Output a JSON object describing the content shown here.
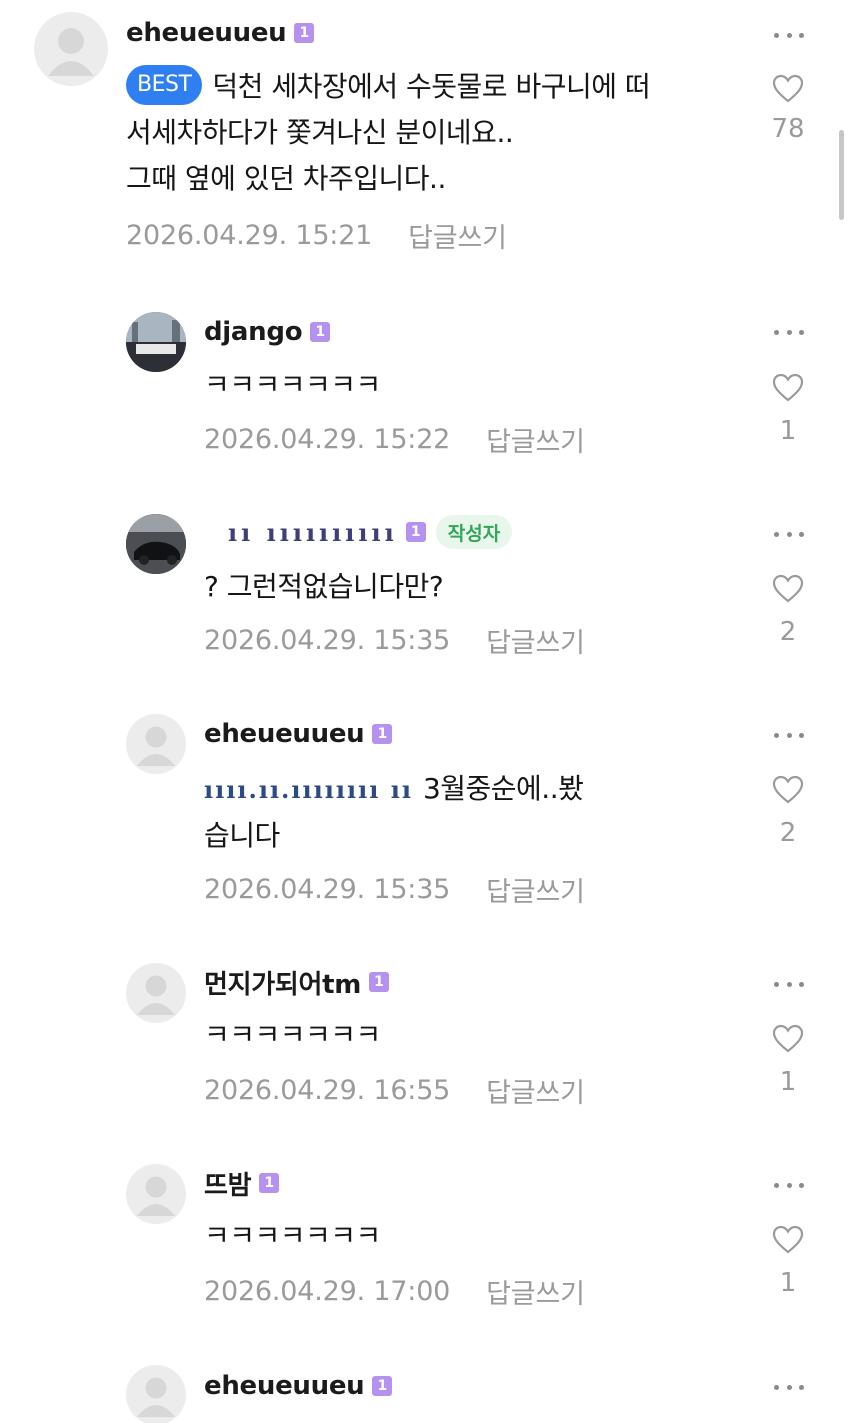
{
  "comments": [
    {
      "username": "eheueuueu",
      "level": "1",
      "badge": "BEST",
      "text": "덕천 세차장에서 수돗물로 바구니에 떠\n서세차하다가 쫓겨나신 분이네요..\n그때 옆에 있던 차주입니다..",
      "timestamp": "2026.04.29. 15:21",
      "reply_label": "답글쓰기",
      "likes": "78"
    },
    {
      "username": "django",
      "level": "1",
      "text": "ㅋㅋㅋㅋㅋㅋㅋ",
      "timestamp": "2026.04.29. 15:22",
      "reply_label": "답글쓰기",
      "likes": "1"
    },
    {
      "username": "ıı ıııııııııı",
      "level": "1",
      "author_badge": "작성자",
      "text": "? 그런적없습니다만?",
      "timestamp": "2026.04.29. 15:35",
      "reply_label": "답글쓰기",
      "likes": "2"
    },
    {
      "username": "eheueuueu",
      "level": "1",
      "masked_prefix": "ıııı.ıı.ıııııııı ıı",
      "text": "3월중순에..봤\n습니다",
      "timestamp": "2026.04.29. 15:35",
      "reply_label": "답글쓰기",
      "likes": "2"
    },
    {
      "username": "먼지가되어tm",
      "level": "1",
      "text": "ㅋㅋㅋㅋㅋㅋㅋ",
      "timestamp": "2026.04.29. 16:55",
      "reply_label": "답글쓰기",
      "likes": "1"
    },
    {
      "username": "뜨밤",
      "level": "1",
      "text": "ㅋㅋㅋㅋㅋㅋㅋ",
      "timestamp": "2026.04.29. 17:00",
      "reply_label": "답글쓰기",
      "likes": "1"
    },
    {
      "username": "eheueuueu",
      "level": "1"
    }
  ],
  "icons": {
    "more": "more-icon",
    "like": "heart-icon",
    "avatar_default": "default-avatar-icon"
  },
  "colors": {
    "best_badge": "#2f7ff0",
    "level_badge": "#b592f0",
    "author_badge_bg": "#e8f6ec",
    "author_badge_text": "#35a55c",
    "meta_text": "#9a9a9a"
  }
}
